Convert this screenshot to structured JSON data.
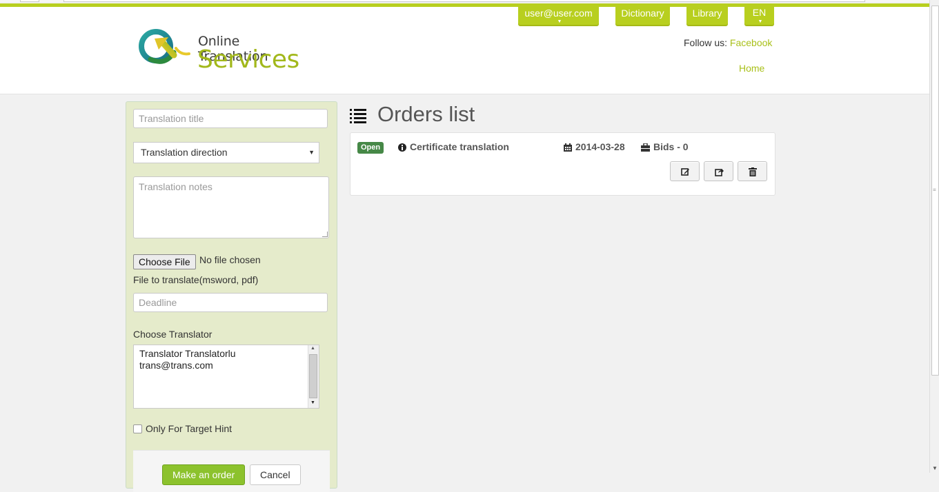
{
  "header": {
    "logo_line1": "Online Translation",
    "logo_line2": "Services",
    "nav": {
      "user": "user@user.com",
      "dictionary": "Dictionary",
      "library": "Library",
      "language": "EN"
    },
    "follow_label": "Follow us:",
    "facebook_link": "Facebook",
    "home_link": "Home"
  },
  "form": {
    "title_placeholder": "Translation title",
    "direction_selected": "Translation direction",
    "notes_placeholder": "Translation notes",
    "file_button": "Choose File",
    "file_status": "No file chosen",
    "file_label": "File to translate(msword, pdf)",
    "deadline_placeholder": "Deadline",
    "translator_label": "Choose Translator",
    "translator_option_line1": "Translator Translatorlu",
    "translator_option_line2": "trans@trans.com",
    "target_hint_label": "Only For Target Hint",
    "submit_label": "Make an order",
    "cancel_label": "Cancel"
  },
  "orders": {
    "title": "Orders list",
    "items": [
      {
        "status": "Open",
        "name": "Certificate translation",
        "date": "2014-03-28",
        "bids": "Bids - 0"
      }
    ]
  },
  "colors": {
    "accent": "#b8cf1f",
    "link": "#a9c01a",
    "status_open": "#468847",
    "panel_bg": "#e5ebcb",
    "submit": "#8cc22d"
  },
  "icons": [
    "logo-icon",
    "list-icon",
    "info-icon",
    "calendar-icon",
    "briefcase-icon",
    "edit-icon",
    "share-icon",
    "trash-icon",
    "caret-down-icon"
  ]
}
